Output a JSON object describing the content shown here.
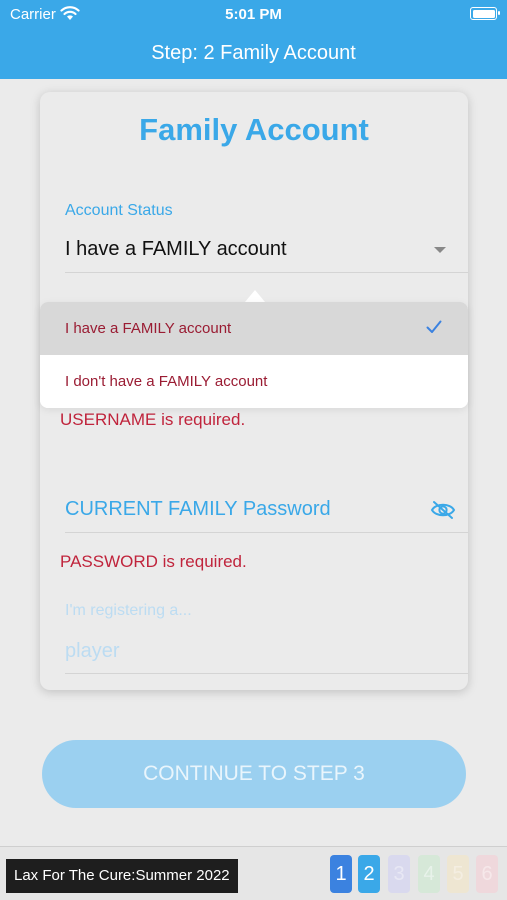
{
  "status_bar": {
    "carrier": "Carrier",
    "time": "5:01 PM"
  },
  "nav": {
    "title": "Step: 2 Family Account"
  },
  "card": {
    "title": "Family Account",
    "account_status": {
      "label": "Account Status",
      "value": "I have a FAMILY account"
    },
    "username_error": "USERNAME is required.",
    "password": {
      "placeholder": "CURRENT FAMILY Password",
      "error": "PASSWORD is required."
    },
    "registering": {
      "label": "I'm registering a...",
      "value": "player"
    }
  },
  "popover": {
    "options": [
      {
        "label": "I have a FAMILY account",
        "selected": true
      },
      {
        "label": "I don't have a FAMILY account",
        "selected": false
      }
    ]
  },
  "continue_button": "CONTINUE TO STEP 3",
  "bottom_bar": {
    "event_name": "Lax For The Cure:Summer 2022",
    "steps": [
      {
        "label": "1",
        "bg": "#3b82e0",
        "fg": "#ffffff"
      },
      {
        "label": "2",
        "bg": "#3aa8e8",
        "fg": "#ffffff"
      },
      {
        "label": "3",
        "bg": "#d9d9ee",
        "fg": "#e8e8f4"
      },
      {
        "label": "4",
        "bg": "#d6e8d8",
        "fg": "#e8f2ea"
      },
      {
        "label": "5",
        "bg": "#eee6d2",
        "fg": "#f4eee2"
      },
      {
        "label": "6",
        "bg": "#efd8dc",
        "fg": "#f6e8ea"
      }
    ]
  },
  "colors": {
    "accent": "#3aa8e8",
    "error": "#c0243c"
  }
}
